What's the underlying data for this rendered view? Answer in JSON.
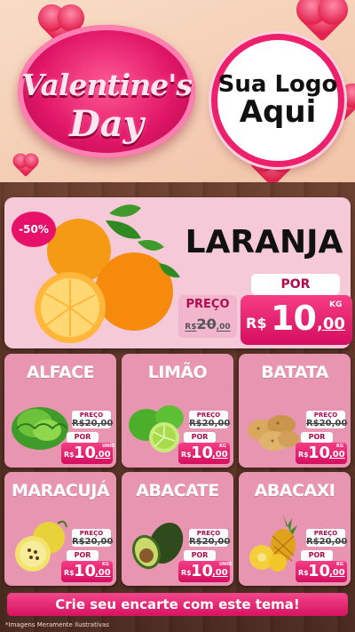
{
  "header": {
    "title_line1": "Valentine's",
    "title_line2": "Day",
    "logo_line1": "Sua Logo",
    "logo_line2": "Aqui"
  },
  "featured": {
    "discount": "-50%",
    "name": "LARANJA",
    "preco_label": "PREÇO",
    "old_currency": "R$",
    "old_price": "20",
    "old_cents": ",00",
    "por_label": "POR",
    "currency": "R$",
    "price_int": "10",
    "price_dec": ",00",
    "unit": "KG",
    "icon": "orange-icon"
  },
  "products": [
    {
      "name": "ALFACE",
      "preco_label": "PREÇO",
      "old_price": "R$20,00",
      "por_label": "POR",
      "currency": "R$",
      "price_int": "10",
      "price_dec": ",00",
      "unit": "UNID",
      "icon": "lettuce-icon"
    },
    {
      "name": "LIMÃO",
      "preco_label": "PREÇO",
      "old_price": "R$20,00",
      "por_label": "POR",
      "currency": "R$",
      "price_int": "10",
      "price_dec": ",00",
      "unit": "KG",
      "icon": "lime-icon"
    },
    {
      "name": "BATATA",
      "preco_label": "PREÇO",
      "old_price": "R$20,00",
      "por_label": "POR",
      "currency": "R$",
      "price_int": "10",
      "price_dec": ",00",
      "unit": "KG",
      "icon": "potato-icon"
    },
    {
      "name": "MARACUJÁ",
      "preco_label": "PREÇO",
      "old_price": "R$20,00",
      "por_label": "POR",
      "currency": "R$",
      "price_int": "10",
      "price_dec": ",00",
      "unit": "KG",
      "icon": "passion-fruit-icon"
    },
    {
      "name": "ABACATE",
      "preco_label": "PREÇO",
      "old_price": "R$20,00",
      "por_label": "POR",
      "currency": "R$",
      "price_int": "10",
      "price_dec": ",00",
      "unit": "UNID",
      "icon": "avocado-icon"
    },
    {
      "name": "ABACAXI",
      "preco_label": "PREÇO",
      "old_price": "R$20,00",
      "por_label": "POR",
      "currency": "R$",
      "price_int": "10",
      "price_dec": ",00",
      "unit": "KG",
      "icon": "pineapple-icon"
    }
  ],
  "footer": {
    "cta": "Crie seu encarte com este tema!",
    "disclaimer": "*Imagens Meramente Ilustrativas"
  },
  "colors": {
    "accent": "#e8116a",
    "card_bg": "#e895b1",
    "featured_bg": "#f5c9d8",
    "wood": "#5a3325"
  }
}
